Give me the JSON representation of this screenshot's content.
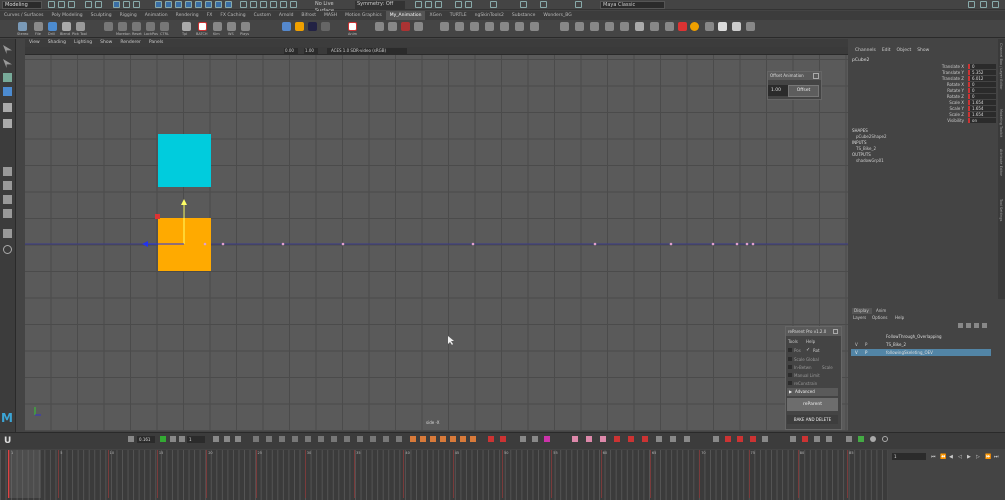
{
  "app": {
    "mode": "Modeling",
    "live_surface": "No Live Surface",
    "symmetry": "Symmetry: Off",
    "workspace": "Maya Classic"
  },
  "shelf_tabs": [
    "Curves / Surfaces",
    "Poly Modeling",
    "Sculpting",
    "Rigging",
    "Animation",
    "Rendering",
    "FX",
    "FX Caching",
    "Custom",
    "Arnold",
    "Bifrost",
    "MASH",
    "Motion Graphics",
    "My_Animation",
    "XGen",
    "TURTLE",
    "ngSkinTools2",
    "Substance",
    "Wonders_BG"
  ],
  "shelf_active": "My_Animation",
  "shelf_labels": [
    "Stereo",
    "File",
    "Drill",
    "Blend",
    "Pick Tool",
    "Moreton",
    "Reset",
    "LockPos",
    "CTRL",
    "Tpl",
    "BATCH",
    "Kim",
    "WS",
    "Plays",
    "Anim"
  ],
  "viewport": {
    "menu": [
      "View",
      "Shading",
      "Lighting",
      "Show",
      "Renderer",
      "Panels"
    ],
    "field_a": "0.00",
    "field_b": "1.00",
    "color_space": "ACES 1.0 SDR-video (sRGB)",
    "camera_label": "side -X"
  },
  "offset_popup": {
    "title": "Offset Animation",
    "value": "1.00",
    "button": "Offset"
  },
  "reparent": {
    "title": "reParent Pro v1.2.0",
    "menu": [
      "Tools",
      "Help"
    ],
    "lines": [
      "Pos",
      "Rot",
      "Scale Global",
      "In-Betwn",
      "Scale",
      "Manual Limit",
      "reConstrain"
    ],
    "advanced": "Advanced",
    "button": "reParent",
    "bake": "BAKE AND DELETE"
  },
  "channel_box": {
    "menu": [
      "Channels",
      "Edit",
      "Object",
      "Show"
    ],
    "object": "pCube2",
    "attributes": [
      {
        "label": "Translate X",
        "value": "0"
      },
      {
        "label": "Translate Y",
        "value": "5.352"
      },
      {
        "label": "Translate Z",
        "value": "6.012"
      },
      {
        "label": "Rotate X",
        "value": "0"
      },
      {
        "label": "Rotate Y",
        "value": "0"
      },
      {
        "label": "Rotate Z",
        "value": "0"
      },
      {
        "label": "Scale X",
        "value": "1.654"
      },
      {
        "label": "Scale Y",
        "value": "1.654"
      },
      {
        "label": "Scale Z",
        "value": "1.654"
      },
      {
        "label": "Visibility",
        "value": "on"
      }
    ],
    "shapes_head": "SHAPES",
    "shape": "pCube2Shape2",
    "inputs_head": "INPUTS",
    "input": "TS_Bike_2",
    "outputs_head": "OUTPUTS",
    "output": "shadowGrp01"
  },
  "right_tabs": [
    "Channel Box / Layer Editor",
    "Modeling Toolkit",
    "Attribute Editor",
    "Tool Settings"
  ],
  "layer_editor": {
    "tabs": [
      "Display",
      "Anim"
    ],
    "menu": [
      "Layers",
      "Options",
      "Help"
    ],
    "layers": [
      {
        "name": "FollowThrough_Overlapping",
        "selected": false
      },
      {
        "name": "TS_Bike_2",
        "selected": false
      },
      {
        "name": "followingSkeleting_OEV",
        "selected": true
      }
    ]
  },
  "playback": {
    "current_time": "0.161",
    "frame": "1",
    "end_field": "1"
  },
  "timeline": {
    "labels": [
      "1",
      "5",
      "10",
      "15",
      "20",
      "25",
      "30",
      "35",
      "40",
      "45",
      "50",
      "55",
      "60",
      "65",
      "70",
      "75",
      "80",
      "85"
    ]
  },
  "colors": {
    "cube_top": "#00ccdd",
    "cube_bottom": "#ffaa00",
    "selected_layer": "#5285a6",
    "key_red": "#cc3333"
  }
}
